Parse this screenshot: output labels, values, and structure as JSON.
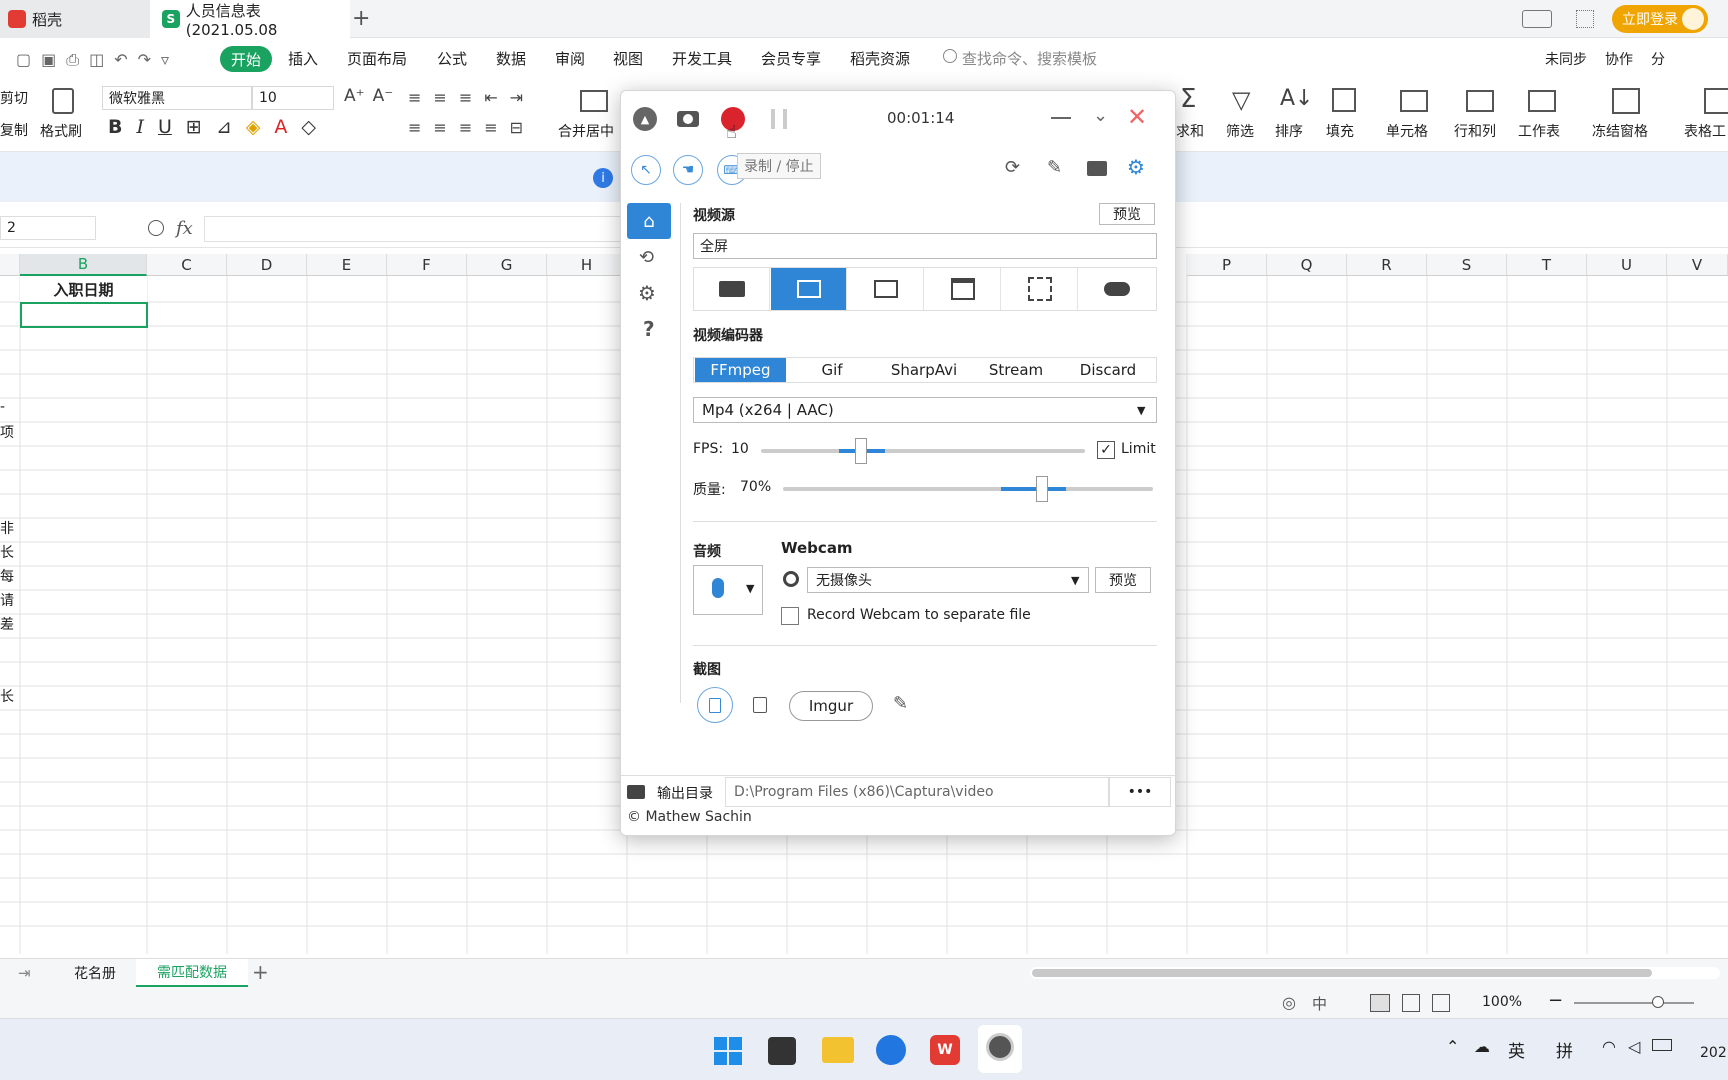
{
  "tabs": {
    "app": "稻壳",
    "file": "人员信息表(2021.05.08"
  },
  "login": "立即登录",
  "menu": [
    "开始",
    "插入",
    "页面布局",
    "公式",
    "数据",
    "审阅",
    "视图",
    "开发工具",
    "会员专享",
    "稻壳资源"
  ],
  "search_placeholder": "查找命令、搜索模板",
  "right_menu": {
    "sync": "未同步",
    "collab": "协作",
    "share": "分"
  },
  "ribbon": {
    "cut": "剪切",
    "copy": "复制",
    "format_painter": "格式刷",
    "font": "微软雅黑",
    "size": "10",
    "merge": "合并居中",
    "sum": "求和",
    "filter": "筛选",
    "sort": "排序",
    "fill": "填充",
    "cell": "单元格",
    "rowcol": "行和列",
    "sheet": "工作表",
    "freeze": "冻结窗格",
    "table_tools": "表格工"
  },
  "cell_ref": "2",
  "columns": [
    "B",
    "C",
    "D",
    "E",
    "F",
    "G",
    "H",
    "P",
    "Q",
    "R",
    "S",
    "T",
    "U",
    "V"
  ],
  "cell_B1": "入职日期",
  "left_fragments": [
    "-",
    "项",
    "",
    "非",
    "长",
    "每",
    "请",
    "差",
    "",
    "长"
  ],
  "sheet_tabs": [
    "花名册",
    "需匹配数据"
  ],
  "status": {
    "zoom": "100%"
  },
  "captura": {
    "timer": "00:01:14",
    "tooltip": "录制 / 停止",
    "video_source_label": "视频源",
    "preview": "预览",
    "source_value": "全屏",
    "encoder_label": "视频编码器",
    "encoders": [
      "FFmpeg",
      "Gif",
      "SharpAvi",
      "Stream",
      "Discard"
    ],
    "format": "Mp4 (x264 | AAC)",
    "fps_label": "FPS:",
    "fps_value": "10",
    "fps_level": 0.31,
    "limit": "Limit",
    "quality_label": "质量:",
    "quality_value": "70%",
    "quality_level": 0.7,
    "audio_label": "音频",
    "webcam_label": "Webcam",
    "webcam_value": "无摄像头",
    "webcam_preview": "预览",
    "webcam_separate": "Record Webcam to separate file",
    "screenshot_label": "截图",
    "imgur": "Imgur",
    "output_label": "输出目录",
    "output_path": "D:\\Program Files (x86)\\Captura\\video",
    "more": "•••",
    "copyright": "© Mathew Sachin"
  },
  "taskbar": {
    "lang1": "英",
    "lang2": "拼",
    "clock": "202"
  }
}
